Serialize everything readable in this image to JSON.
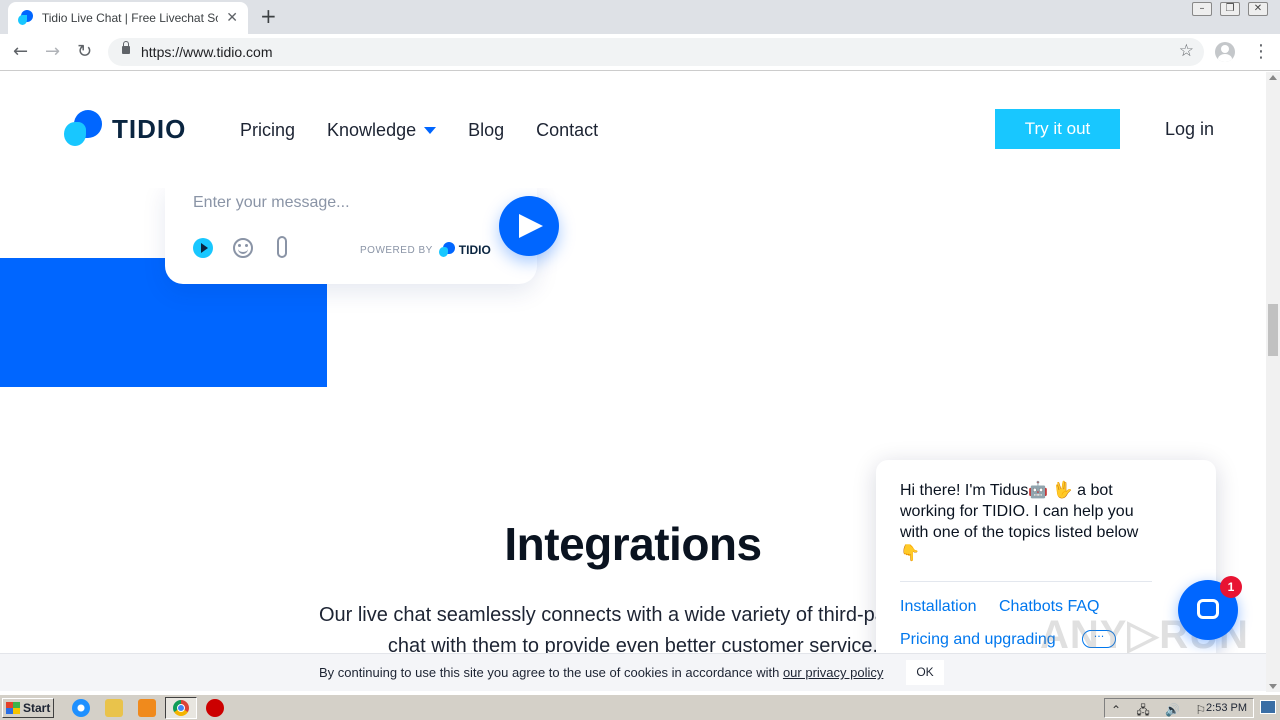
{
  "browser": {
    "tab_title": "Tidio Live Chat | Free Livechat Soluti",
    "tab_close": "✕",
    "new_tab": "+",
    "url": "https://www.tidio.com",
    "win_minimize": "–",
    "win_restore": "❐",
    "win_close": "✕"
  },
  "site": {
    "logo_text": "TIDIO",
    "nav": {
      "pricing": "Pricing",
      "knowledge": "Knowledge",
      "blog": "Blog",
      "contact": "Contact"
    },
    "try_button": "Try it out",
    "login": "Log in"
  },
  "chat_demo": {
    "placeholder": "Enter your message...",
    "powered_by": "POWERED BY",
    "powered_brand": "TIDIO"
  },
  "integrations": {
    "title": "Integrations",
    "text_line1": "Our live chat seamlessly connects with a wide variety of third-party app",
    "text_line2": "chat with them to provide even better customer service."
  },
  "bot": {
    "message": "Hi there! I'm Tidus🤖 🖖 a bot working for TIDIO. I can help you with one of the topics listed below👇",
    "options": [
      "Installation",
      "Chatbots FAQ",
      "Pricing and upgrading"
    ],
    "more": "···",
    "badge_count": "1"
  },
  "watermark": "ANY▷RUN",
  "cookie": {
    "text": "By continuing to use this site you agree to the use of cookies in accordance with ",
    "link": "our privacy policy",
    "ok": "OK"
  },
  "taskbar": {
    "start": "Start",
    "tray_icons": "⌃ 🖧 🔊 ⚐",
    "clock": "2:53 PM"
  },
  "colors": {
    "brand_blue": "#0066ff",
    "brand_cyan": "#18c7ff",
    "link_blue": "#0077ee",
    "badge_red": "#e81332"
  }
}
